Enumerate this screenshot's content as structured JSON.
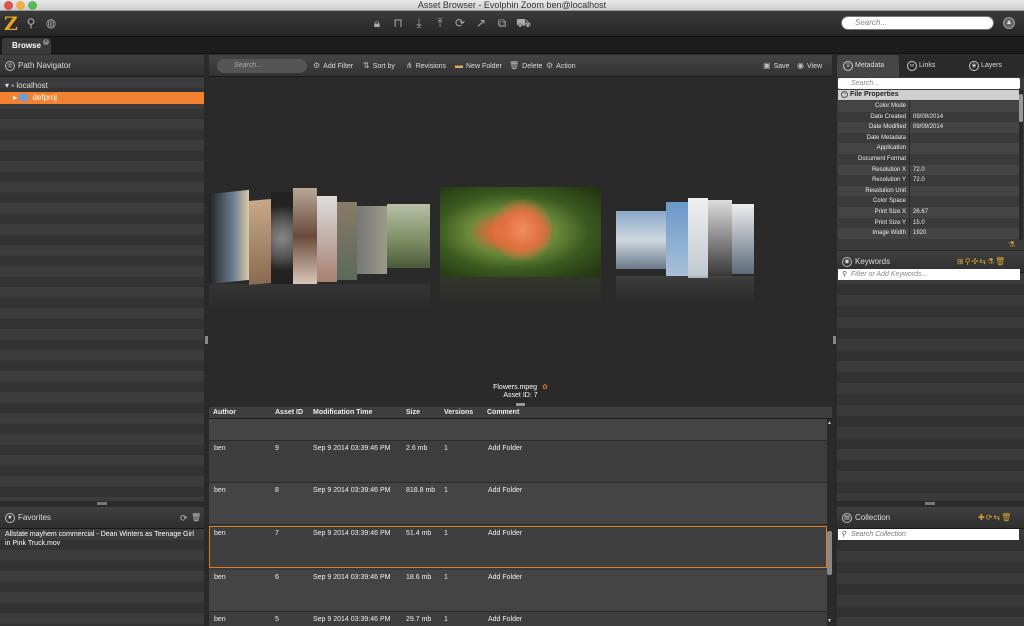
{
  "window": {
    "title": "Asset Browser - Evolphin Zoom ben@localhost"
  },
  "toolbar": {
    "logo": "Z",
    "search_placeholder": "Search...",
    "icons": [
      "search-icon",
      "globe-icon",
      "lock-icon",
      "unlock-icon",
      "download-icon",
      "upload-icon",
      "sync-icon",
      "share-icon",
      "copy-icon",
      "cart-icon",
      "user-icon"
    ]
  },
  "tabs": [
    {
      "label": "Browse"
    }
  ],
  "path_navigator": {
    "title": "Path Navigator",
    "tree": [
      {
        "label": "localhost",
        "level": 0,
        "expanded": true
      },
      {
        "label": "defproj",
        "level": 1,
        "selected": true
      }
    ]
  },
  "favorites": {
    "title": "Favorites",
    "items": [
      "Allstate mayhem commercial - Dean Winters as Teenage Girl in Pink Truck.mov"
    ]
  },
  "center_toolbar": {
    "search_placeholder": "Search...",
    "add_filter": "Add Filter",
    "sort_by": "Sort by",
    "revisions": "Revisions",
    "new_folder": "New Folder",
    "delete": "Delete",
    "action": "Action",
    "save": "Save",
    "view": "View"
  },
  "viewer": {
    "filename": "Flowers.mpeg",
    "asset_id_label": "Asset ID: 7"
  },
  "table": {
    "columns": [
      "Author",
      "Asset ID",
      "Modification Time",
      "Size",
      "Versions",
      "Comment"
    ],
    "rows": [
      {
        "author": "ben",
        "asset_id": "9",
        "time": "Sep 9 2014 03:39:46 PM",
        "size": "2.6 mb",
        "versions": "1",
        "comment": "Add Folder"
      },
      {
        "author": "ben",
        "asset_id": "8",
        "time": "Sep 9 2014 03:39:46 PM",
        "size": "818.8 mb",
        "versions": "1",
        "comment": "Add Folder"
      },
      {
        "author": "ben",
        "asset_id": "7",
        "time": "Sep 9 2014 03:39:46 PM",
        "size": "51.4 mb",
        "versions": "1",
        "comment": "Add Folder"
      },
      {
        "author": "ben",
        "asset_id": "6",
        "time": "Sep 9 2014 03:39:46 PM",
        "size": "18.6 mb",
        "versions": "1",
        "comment": "Add Folder"
      },
      {
        "author": "ben",
        "asset_id": "5",
        "time": "Sep 9 2014 03:39:46 PM",
        "size": "29.7 mb",
        "versions": "1",
        "comment": "Add Folder"
      }
    ]
  },
  "right_panel": {
    "tabs": [
      "Metadata",
      "Links",
      "Layers"
    ],
    "search_placeholder": "Search...",
    "section_title": "File Properties",
    "properties": [
      {
        "key": "Color Mode",
        "value": ""
      },
      {
        "key": "Date Created",
        "value": "09/09/2014"
      },
      {
        "key": "Date Modified",
        "value": "09/09/2014"
      },
      {
        "key": "Date Metadata",
        "value": ""
      },
      {
        "key": "Application",
        "value": ""
      },
      {
        "key": "Document Format",
        "value": ""
      },
      {
        "key": "Resolution X",
        "value": "72.0"
      },
      {
        "key": "Resolution Y",
        "value": "72.0"
      },
      {
        "key": "Resolution Unit",
        "value": ""
      },
      {
        "key": "Color Space",
        "value": ""
      },
      {
        "key": "Print Size X",
        "value": "26.67"
      },
      {
        "key": "Print Size Y",
        "value": "15.0"
      },
      {
        "key": "Image Width",
        "value": "1920"
      }
    ],
    "keywords_title": "Keywords",
    "keywords_placeholder": "Filter or Add Keywords...",
    "collection_title": "Collection",
    "collection_placeholder": "Search Collection"
  }
}
